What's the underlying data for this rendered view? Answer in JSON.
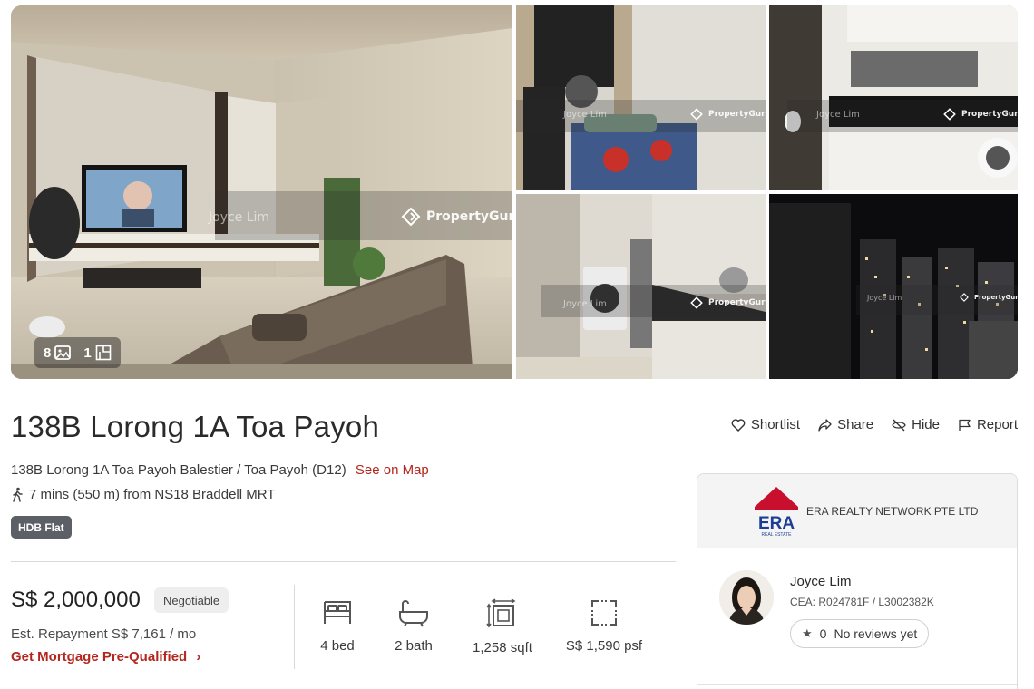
{
  "gallery": {
    "watermark_brand": "PropertyGuru",
    "watermark_agent": "Joyce Lim",
    "photo_count": "8",
    "floorplan_count": "1"
  },
  "listing": {
    "title": "138B Lorong 1A Toa Payoh",
    "address": "138B Lorong 1A Toa Payoh Balestier / Toa Payoh (D12)",
    "see_on_map": "See on Map",
    "mrt": "7 mins (550 m) from NS18 Braddell MRT",
    "property_type": "HDB Flat"
  },
  "actions": {
    "shortlist": "Shortlist",
    "share": "Share",
    "hide": "Hide",
    "report": "Report"
  },
  "price": {
    "amount": "S$ 2,000,000",
    "negotiable": "Negotiable",
    "repayment": "Est. Repayment S$ 7,161 / mo",
    "mortgage_link": "Get Mortgage Pre-Qualified"
  },
  "specs": {
    "beds": "4 bed",
    "baths": "2 bath",
    "size": "1,258 sqft",
    "psf": "S$ 1,590 psf"
  },
  "agent": {
    "agency_logo": "ERA",
    "agency_logo_sub": "REAL ESTATE",
    "agency_name": "ERA REALTY NETWORK PTE LTD",
    "name": "Joyce Lim",
    "cea": "CEA: R024781F / L3002382K",
    "rating": "0",
    "reviews_label": "No reviews yet"
  },
  "colors": {
    "accent_red": "#b3261e",
    "tag_bg": "#5c6066",
    "divider": "#d9d9d9"
  }
}
